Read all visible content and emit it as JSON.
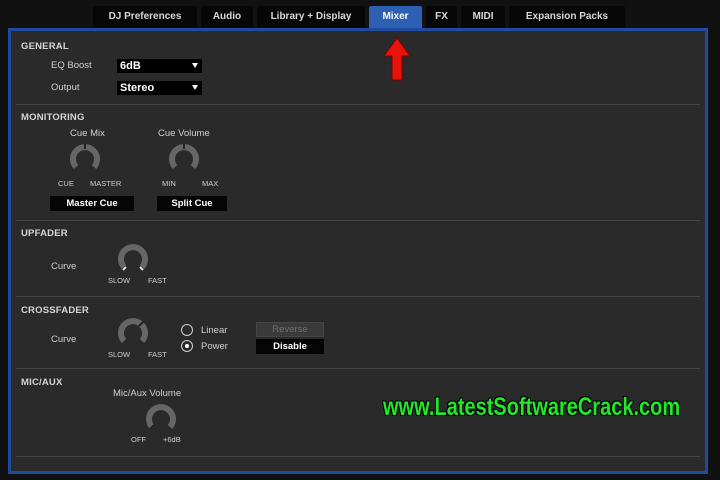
{
  "tabs": [
    {
      "label": "DJ Preferences",
      "active": false
    },
    {
      "label": "Audio",
      "active": false
    },
    {
      "label": "Library + Display",
      "active": false
    },
    {
      "label": "Mixer",
      "active": true
    },
    {
      "label": "FX",
      "active": false
    },
    {
      "label": "MIDI",
      "active": false
    },
    {
      "label": "Expansion Packs",
      "active": false
    }
  ],
  "general": {
    "title": "GENERAL",
    "eq_boost_label": "EQ Boost",
    "eq_boost_value": "6dB",
    "output_label": "Output",
    "output_value": "Stereo"
  },
  "monitoring": {
    "title": "MONITORING",
    "cue_mix_label": "Cue Mix",
    "cue_mix_min": "CUE",
    "cue_mix_max": "MASTER",
    "cue_volume_label": "Cue Volume",
    "cue_volume_min": "MIN",
    "cue_volume_max": "MAX",
    "master_cue_button": "Master Cue",
    "split_cue_button": "Split Cue"
  },
  "upfader": {
    "title": "UPFADER",
    "curve_label": "Curve",
    "min": "SLOW",
    "max": "FAST"
  },
  "crossfader": {
    "title": "CROSSFADER",
    "curve_label": "Curve",
    "min": "SLOW",
    "max": "FAST",
    "linear_label": "Linear",
    "power_label": "Power",
    "selected": "Power",
    "reverse_button": "Reverse",
    "disable_button": "Disable"
  },
  "mic_aux": {
    "title": "MIC/AUX",
    "volume_label": "Mic/Aux Volume",
    "min": "OFF",
    "max": "+6dB"
  },
  "watermark": "www.LatestSoftwareCrack.com",
  "colors": {
    "active_tab": "#2d5fb3",
    "frame_border": "#1e4aa0",
    "panel_bg": "#2a2a2a",
    "watermark": "#22e82a",
    "arrow": "#e8140c"
  }
}
